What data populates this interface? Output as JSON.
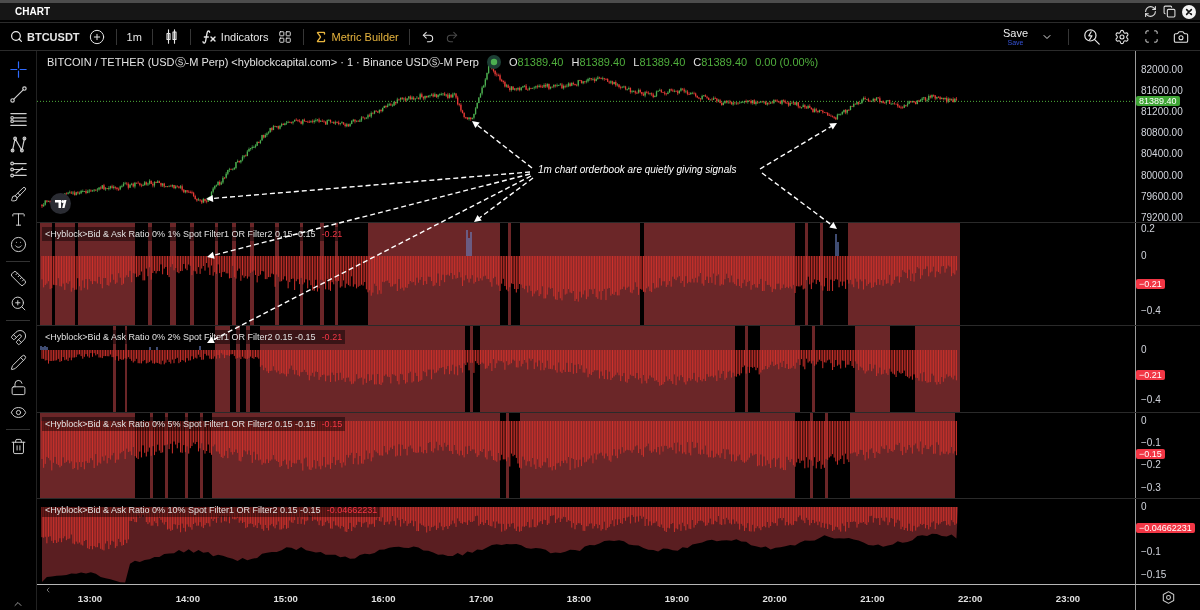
{
  "window": {
    "title": "CHART"
  },
  "toolbar": {
    "symbol": "BTCUSDT",
    "interval": "1m",
    "indicators": "Indicators",
    "metric_builder": "Metric Builder",
    "undo": {
      "disabled": false
    },
    "redo": {
      "disabled": true
    },
    "save": {
      "label": "Save",
      "status": "Save"
    }
  },
  "drawing_tools": [
    [
      {
        "kind": "crosshair",
        "selected": true
      },
      {
        "kind": "trendline",
        "selected": false
      },
      {
        "kind": "lines",
        "selected": false
      },
      {
        "kind": "pattern",
        "selected": false
      },
      {
        "kind": "fib",
        "selected": false
      },
      {
        "kind": "brush",
        "selected": false
      },
      {
        "kind": "text",
        "selected": false
      },
      {
        "kind": "emoji",
        "selected": false
      }
    ],
    [
      {
        "kind": "ruler",
        "selected": false
      },
      {
        "kind": "zoom",
        "selected": false
      }
    ],
    [
      {
        "kind": "magnet",
        "selected": false
      },
      {
        "kind": "drawlock",
        "selected": false
      },
      {
        "kind": "lock",
        "selected": false
      },
      {
        "kind": "visibility",
        "selected": false
      }
    ],
    [
      {
        "kind": "trash",
        "selected": false
      }
    ]
  ],
  "price_pane": {
    "title": "BITCOIN / TETHER (USDⓈ-M Perp) <hyblockcapital.com> · 1 · Binance USDⓈ-M Perp",
    "ohlc": [
      {
        "key": "O",
        "value": "81389.40"
      },
      {
        "key": "H",
        "value": "81389.40"
      },
      {
        "key": "L",
        "value": "81389.40"
      },
      {
        "key": "C",
        "value": "81389.40"
      }
    ],
    "change": "0.00 (0.00%)",
    "axis_ticks": [
      "82000.00",
      "81600.00",
      "81200.00",
      "80800.00",
      "80400.00",
      "80000.00",
      "79600.00",
      "79200.00"
    ],
    "last_price": "81389.40"
  },
  "indicator_panes": [
    {
      "legend": "<Hyblock>Bid & Ask Ratio 0% 1% Spot Filter1 OR Filter2 0.15 -0.15",
      "value": "-0.21",
      "axis_ticks": [
        "0.2",
        "0",
        "−0.4"
      ],
      "badge": "−0.21"
    },
    {
      "legend": "<Hyblock>Bid & Ask Ratio 0% 2% Spot Filter1 OR Filter2 0.15 -0.15",
      "value": "-0.21",
      "axis_ticks": [
        "0",
        "−0.4"
      ],
      "badge": "−0.21"
    },
    {
      "legend": "<Hyblock>Bid & Ask Ratio 0% 5% Spot Filter1 OR Filter2 0.15 -0.15",
      "value": "-0.15",
      "axis_ticks": [
        "0",
        "−0.1",
        "−0.2",
        "−0.3"
      ],
      "badge": "−0.15"
    },
    {
      "legend": "<Hyblock>Bid & Ask Ratio 0% 10% Spot Filter1 OR Filter2 0.15 -0.15",
      "value": "-0.04662231",
      "axis_ticks": [
        "0",
        "−0.1",
        "−0.15"
      ],
      "badge": "−0.04662231"
    }
  ],
  "time_axis": [
    "13:00",
    "14:00",
    "15:00",
    "16:00",
    "17:00",
    "18:00",
    "19:00",
    "20:00",
    "21:00",
    "22:00",
    "23:00"
  ],
  "annotation": {
    "text": "1m chart orderbook are quietly giving signals"
  }
}
